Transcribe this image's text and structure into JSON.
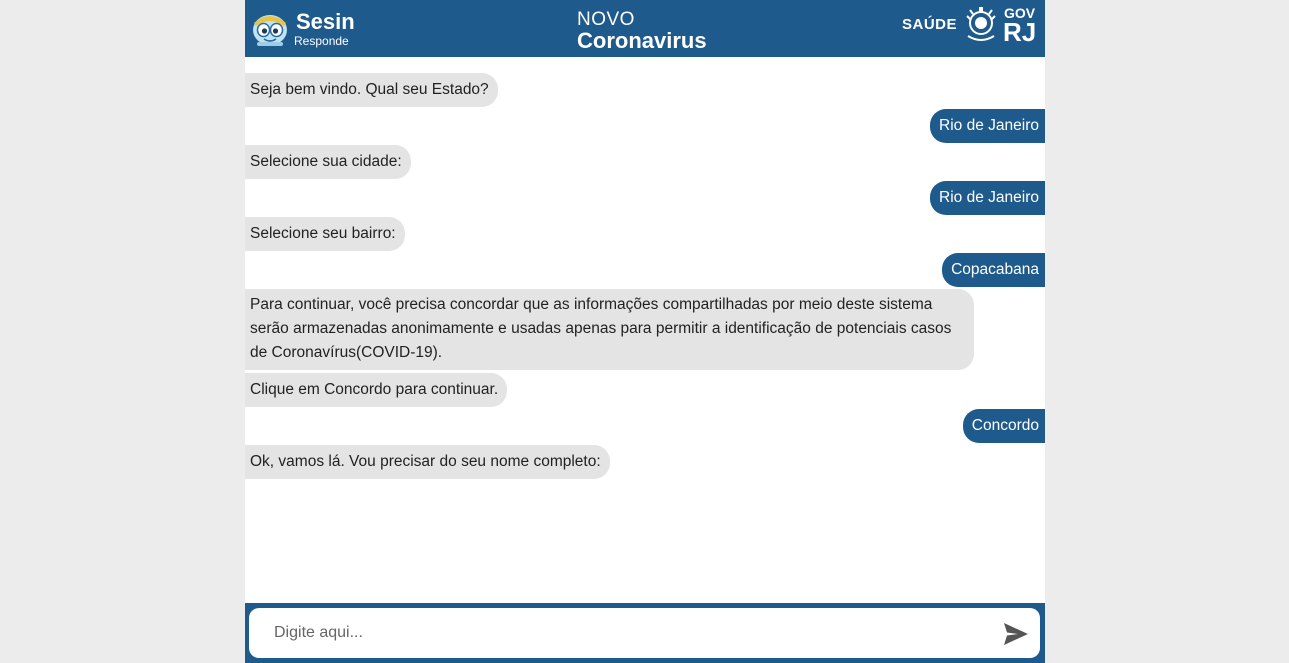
{
  "header": {
    "brand_name": "Sesin",
    "brand_sub": "Responde",
    "title_top": "NOVO",
    "title_main": "Coronavirus",
    "saude": "SAÚDE",
    "gov": "GOV",
    "rj": "RJ"
  },
  "messages": [
    {
      "from": "bot",
      "text": "Seja bem vindo. Qual seu Estado?"
    },
    {
      "from": "user",
      "text": "Rio de Janeiro"
    },
    {
      "from": "bot",
      "text": "Selecione sua cidade:"
    },
    {
      "from": "user",
      "text": "Rio de Janeiro"
    },
    {
      "from": "bot",
      "text": "Selecione seu bairro:"
    },
    {
      "from": "user",
      "text": "Copacabana"
    },
    {
      "from": "bot",
      "text": "Para continuar, você precisa concordar que as informações compartilhadas por meio deste sistema serão armazenadas anonimamente e usadas apenas para permitir a identificação de potenciais casos de Coronavírus(COVID-19)."
    },
    {
      "from": "bot",
      "text": "Clique em Concordo para continuar."
    },
    {
      "from": "user",
      "text": "Concordo"
    },
    {
      "from": "bot",
      "text": "Ok, vamos lá. Vou precisar do seu nome completo:"
    }
  ],
  "composer": {
    "placeholder": "Digite aqui...",
    "value": "",
    "send_icon": "send-icon"
  },
  "colors": {
    "brand": "#1f5a8c",
    "bot_bubble": "#e4e4e4",
    "page_bg": "#ececec"
  }
}
